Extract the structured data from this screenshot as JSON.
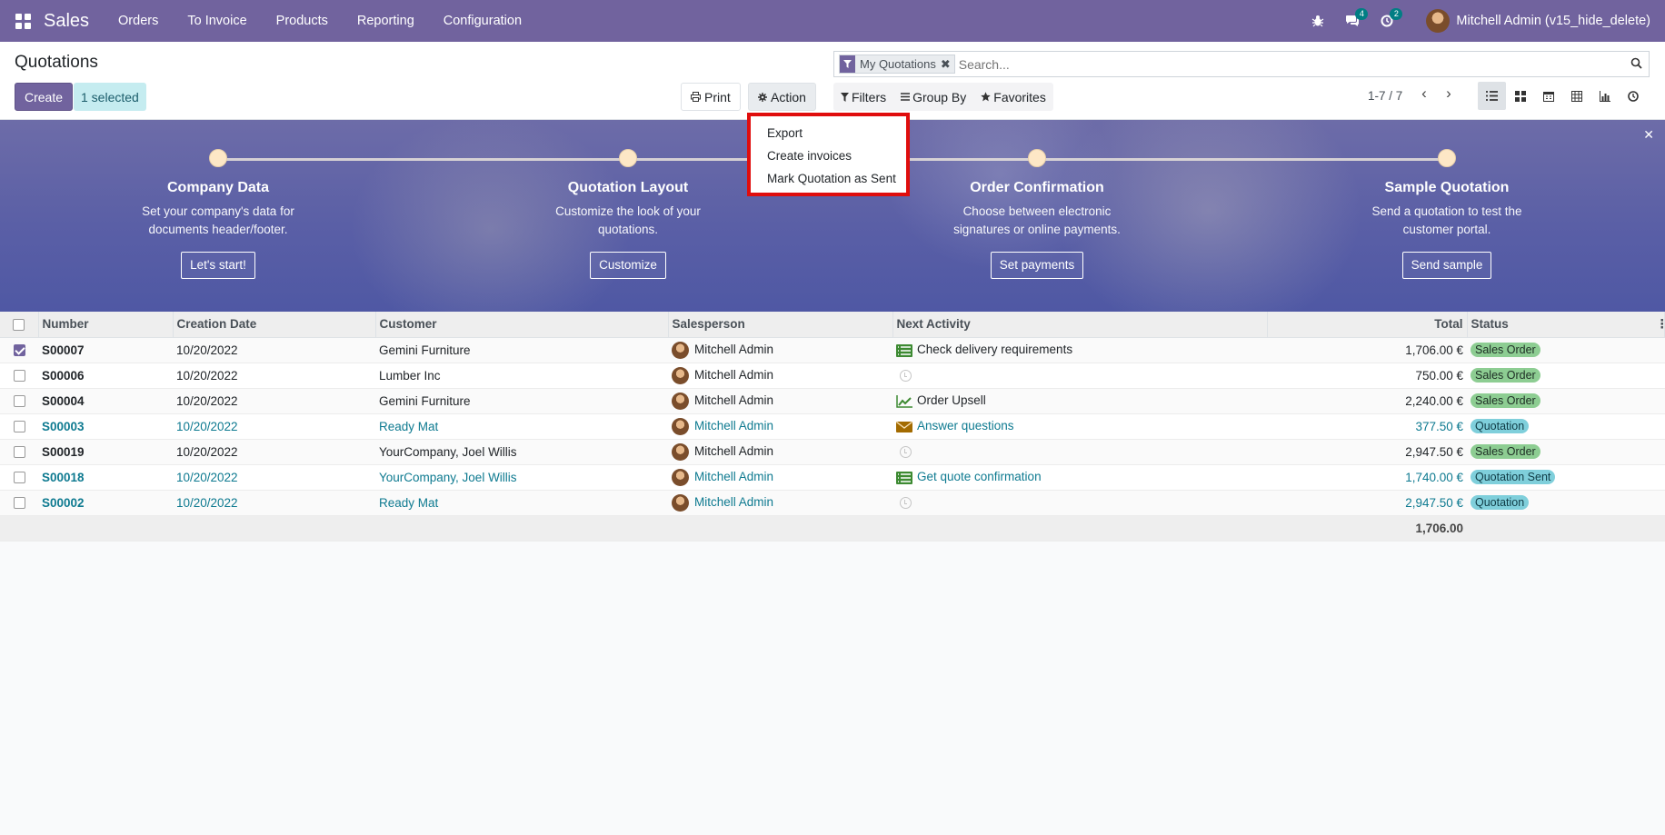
{
  "navbar": {
    "app_name": "Sales",
    "menu": [
      "Orders",
      "To Invoice",
      "Products",
      "Reporting",
      "Configuration"
    ],
    "messages_count": "4",
    "activities_count": "2",
    "user_name": "Mitchell Admin (v15_hide_delete)"
  },
  "control": {
    "title": "Quotations",
    "create_label": "Create",
    "selected_label": "1 selected",
    "print_label": "Print",
    "action_label": "Action",
    "search_facet": "My Quotations",
    "search_placeholder": "Search...",
    "filters_label": "Filters",
    "groupby_label": "Group By",
    "favorites_label": "Favorites",
    "pager": "1-7 / 7",
    "views": [
      "list-icon",
      "kanban-icon",
      "calendar-icon",
      "pivot-icon",
      "graph-icon",
      "activity-icon"
    ]
  },
  "action_menu": [
    "Export",
    "Create invoices",
    "Mark Quotation as Sent"
  ],
  "onboarding": [
    {
      "title": "Company Data",
      "desc": "Set your company's data for documents header/footer.",
      "button": "Let's start!"
    },
    {
      "title": "Quotation Layout",
      "desc": "Customize the look of your quotations.",
      "button": "Customize"
    },
    {
      "title": "Order Confirmation",
      "desc": "Choose between electronic signatures or online payments.",
      "button": "Set payments"
    },
    {
      "title": "Sample Quotation",
      "desc": "Send a quotation to test the customer portal.",
      "button": "Send sample"
    }
  ],
  "table": {
    "columns": [
      "Number",
      "Creation Date",
      "Customer",
      "Salesperson",
      "Next Activity",
      "",
      "Total",
      "Status"
    ],
    "rows": [
      {
        "number": "S00007",
        "date": "10/20/2022",
        "customer": "Gemini Furniture",
        "salesperson": "Mitchell Admin",
        "activity": "Check delivery requirements",
        "activity_icon": "todo-icon",
        "total": "1,706.00 €",
        "status": "Sales Order",
        "status_color": "green",
        "checked": true,
        "link": false
      },
      {
        "number": "S00006",
        "date": "10/20/2022",
        "customer": "Lumber Inc",
        "salesperson": "Mitchell Admin",
        "activity": "",
        "activity_icon": "clock-icon",
        "total": "750.00 €",
        "status": "Sales Order",
        "status_color": "green",
        "checked": false,
        "link": false
      },
      {
        "number": "S00004",
        "date": "10/20/2022",
        "customer": "Gemini Furniture",
        "salesperson": "Mitchell Admin",
        "activity": "Order Upsell",
        "activity_icon": "upsell-icon",
        "total": "2,240.00 €",
        "status": "Sales Order",
        "status_color": "green",
        "checked": false,
        "link": false
      },
      {
        "number": "S00003",
        "date": "10/20/2022",
        "customer": "Ready Mat",
        "salesperson": "Mitchell Admin",
        "activity": "Answer questions",
        "activity_icon": "email-icon",
        "total": "377.50 €",
        "status": "Quotation",
        "status_color": "blue",
        "checked": false,
        "link": true
      },
      {
        "number": "S00019",
        "date": "10/20/2022",
        "customer": "YourCompany, Joel Willis",
        "salesperson": "Mitchell Admin",
        "activity": "",
        "activity_icon": "clock-icon",
        "total": "2,947.50 €",
        "status": "Sales Order",
        "status_color": "green",
        "checked": false,
        "link": false
      },
      {
        "number": "S00018",
        "date": "10/20/2022",
        "customer": "YourCompany, Joel Willis",
        "salesperson": "Mitchell Admin",
        "activity": "Get quote confirmation",
        "activity_icon": "todo-icon",
        "total": "1,740.00 €",
        "status": "Quotation Sent",
        "status_color": "blue",
        "checked": false,
        "link": true
      },
      {
        "number": "S00002",
        "date": "10/20/2022",
        "customer": "Ready Mat",
        "salesperson": "Mitchell Admin",
        "activity": "",
        "activity_icon": "clock-icon",
        "total": "2,947.50 €",
        "status": "Quotation",
        "status_color": "blue",
        "checked": false,
        "link": true
      }
    ],
    "footer_total": "1,706.00"
  }
}
